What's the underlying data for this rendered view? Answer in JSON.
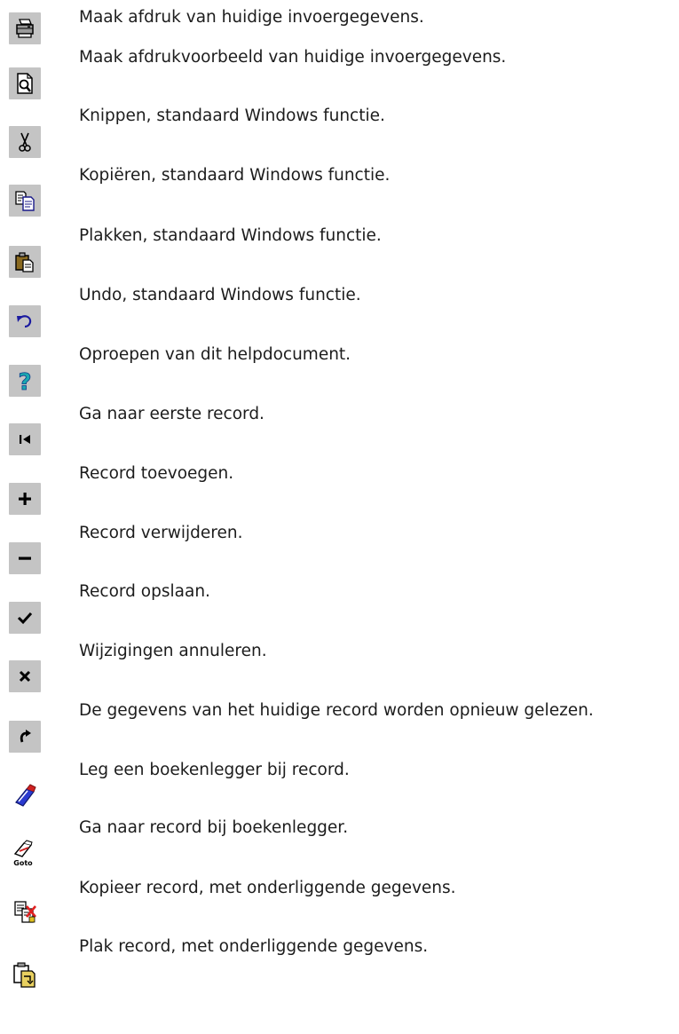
{
  "toolbar_help": {
    "items": [
      {
        "icon": "print-icon",
        "text": "Maak afdruk van huidige invoergegevens."
      },
      {
        "icon": "print-preview-icon",
        "text": "Maak afdrukvoorbeeld van huidige invoergegevens."
      },
      {
        "icon": "cut-icon",
        "text": "Knippen, standaard Windows functie."
      },
      {
        "icon": "copy-icon",
        "text": "Kopiëren, standaard Windows functie."
      },
      {
        "icon": "paste-icon",
        "text": "Plakken, standaard Windows functie."
      },
      {
        "icon": "undo-icon",
        "text": "Undo, standaard Windows functie."
      },
      {
        "icon": "help-icon",
        "text": "Oproepen van dit helpdocument."
      },
      {
        "icon": "first-record-icon",
        "text": "Ga naar eerste record."
      },
      {
        "icon": "add-record-icon",
        "text": "Record toevoegen."
      },
      {
        "icon": "delete-record-icon",
        "text": "Record verwijderen."
      },
      {
        "icon": "save-record-icon",
        "text": "Record opslaan."
      },
      {
        "icon": "cancel-changes-icon",
        "text": "Wijzigingen annuleren."
      },
      {
        "icon": "refresh-record-icon",
        "text": "De gegevens van het huidige record worden opnieuw gelezen."
      },
      {
        "icon": "set-bookmark-icon",
        "text": "Leg  een boekenlegger bij record."
      },
      {
        "icon": "goto-bookmark-icon",
        "text": "Ga naar record bij boekenlegger.",
        "icon_caption": "Goto"
      },
      {
        "icon": "copy-record-icon",
        "text": "Kopieer record, met onderliggende gegevens."
      },
      {
        "icon": "paste-record-icon",
        "text": "Plak record, met onderliggende gegevens."
      }
    ]
  }
}
